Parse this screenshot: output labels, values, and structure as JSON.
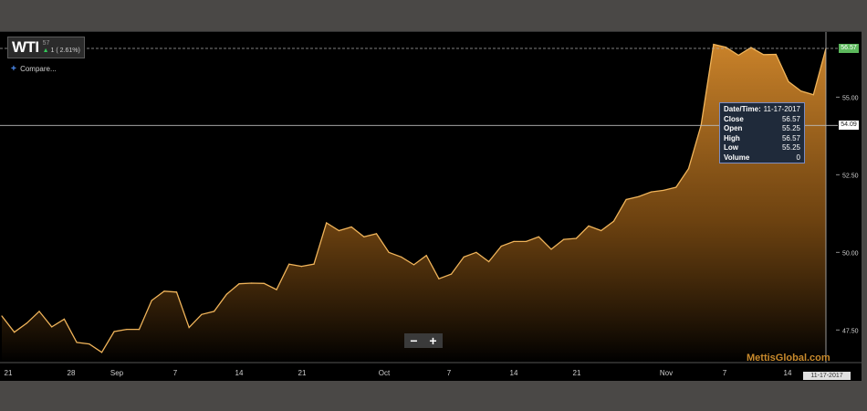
{
  "header": {
    "symbol": "WTI",
    "sub": "57",
    "change": "1 ( 2.61%)",
    "change_arrow": "▲",
    "compare_icon": "+",
    "compare_label": "Compare..."
  },
  "tooltip": {
    "rows": [
      {
        "label": "Date/Time:",
        "value": "11-17-2017"
      },
      {
        "label": "Close",
        "value": "56.57"
      },
      {
        "label": "Open",
        "value": "55.25"
      },
      {
        "label": "High",
        "value": "56.57"
      },
      {
        "label": "Low",
        "value": "55.25"
      },
      {
        "label": "Volume",
        "value": "0"
      }
    ]
  },
  "controls": {
    "zoom_out": "−",
    "zoom_in": "+"
  },
  "watermark": "MettisGlobal.com",
  "cursor_date": "11-17-2017",
  "current_price_label": "56.57",
  "crosshair_price_label": "54.09",
  "colors": {
    "background": "#000000",
    "frame": "#4a4846",
    "area_top": "#d4892c",
    "area_bottom": "#000000",
    "line": "#f0b45a",
    "current_badge": "#5cb85c"
  },
  "chart_data": {
    "type": "area",
    "series": [
      {
        "values": [
          47.95,
          47.43,
          47.72,
          48.1,
          47.6,
          47.85,
          47.1,
          47.05,
          46.78,
          47.45,
          47.52,
          47.52,
          48.45,
          48.75,
          48.72,
          47.58,
          48.0,
          48.1,
          48.65,
          48.99,
          49.01,
          49.0,
          48.8,
          49.62,
          49.55,
          49.62,
          50.95,
          50.7,
          50.82,
          50.5,
          50.6,
          50.0,
          49.85,
          49.6,
          49.9,
          49.15,
          49.3,
          49.85,
          50.0,
          49.7,
          50.2,
          50.35,
          50.35,
          50.5,
          50.1,
          50.42,
          50.45,
          50.85,
          50.7,
          51.0,
          51.7,
          51.8,
          51.95,
          52.0,
          52.1,
          52.7,
          54.1,
          56.7,
          56.61,
          56.35,
          56.6,
          56.37,
          56.38,
          55.5,
          55.2,
          55.08,
          56.57
        ]
      }
    ],
    "x_labels": [
      "21",
      "28",
      "Sep",
      "7",
      "14",
      "21",
      "Oct",
      "7",
      "14",
      "21",
      "Nov",
      "7",
      "14"
    ],
    "y_ticks": [
      47.5,
      50.0,
      52.5,
      55.0
    ],
    "y_tick_labels": [
      "47.50",
      "50.00",
      "52.50",
      "55.00"
    ],
    "ylim": [
      46.45,
      57.1
    ],
    "grid": false,
    "current_value": 56.57,
    "crosshair_value": 54.09
  }
}
